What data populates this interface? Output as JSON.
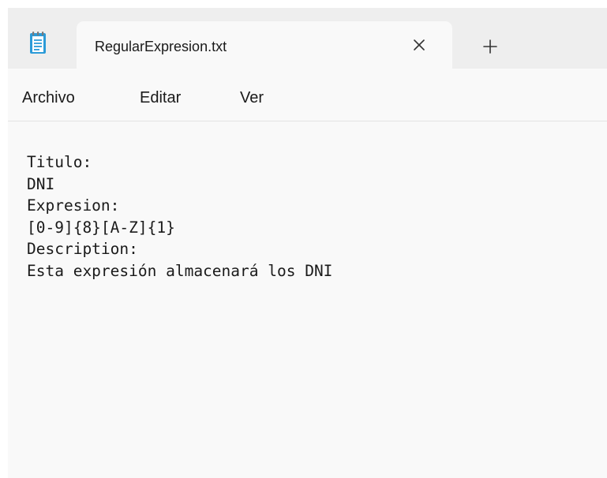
{
  "window": {
    "tab_title": "RegularExpresion.txt",
    "close_glyph": "×",
    "new_tab_glyph": "+",
    "app_icon": "notepad-icon"
  },
  "menu": {
    "items": [
      "Archivo",
      "Editar",
      "Ver"
    ]
  },
  "editor": {
    "lines": [
      "Titulo:",
      "DNI",
      "Expresion:",
      "[0-9]{8}[A-Z]{1}",
      "Description:",
      "Esta expresión almacenará los DNI"
    ]
  },
  "colors": {
    "titlebar_bg": "#eeeeee",
    "content_bg": "#f9f9f9",
    "text": "#1a1a1a",
    "icon_accent": "#2b9bd8"
  }
}
